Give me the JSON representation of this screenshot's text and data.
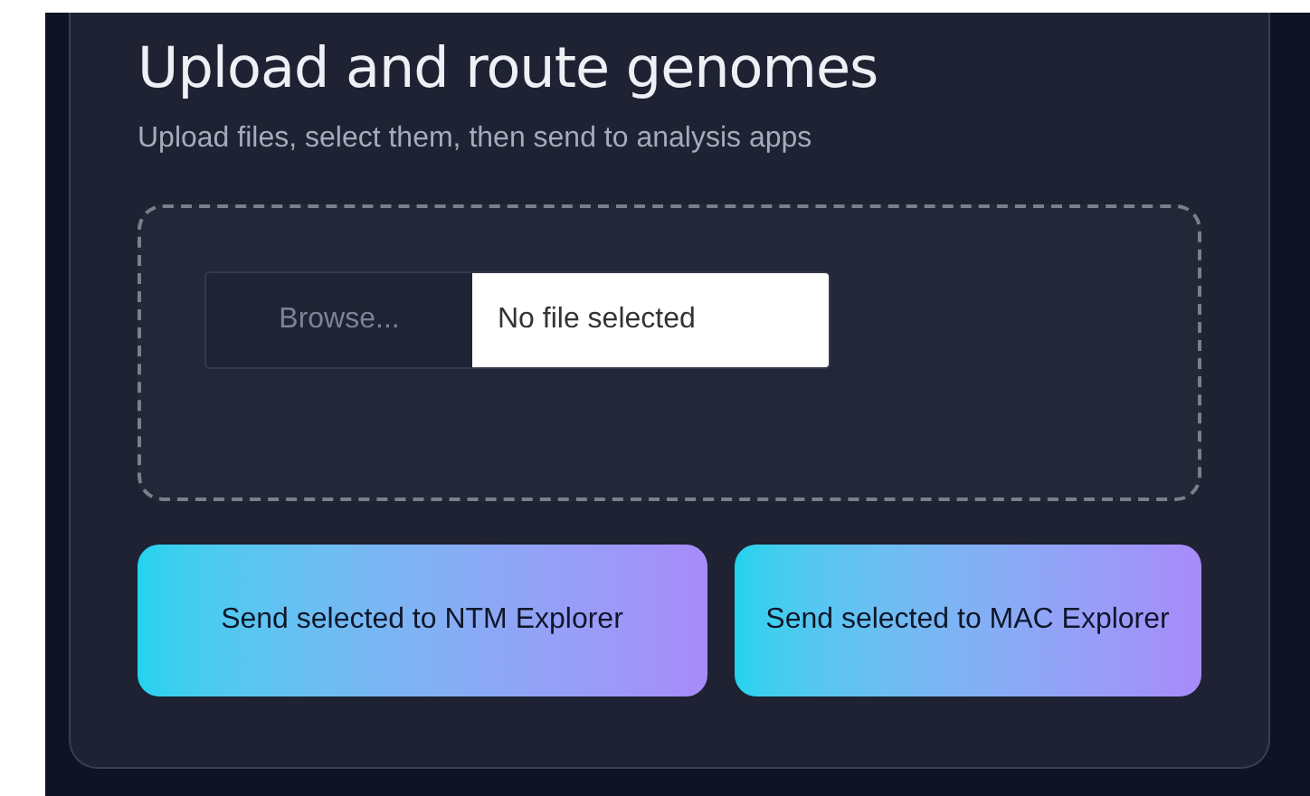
{
  "heading": "Upload and route genomes",
  "subtitle": "Upload files, select them, then send to analysis apps",
  "file_input": {
    "button": "Browse...",
    "value": "No file selected"
  },
  "buttons": [
    "Send selected to NTM Explorer",
    "Send selected to MAC Explorer"
  ]
}
